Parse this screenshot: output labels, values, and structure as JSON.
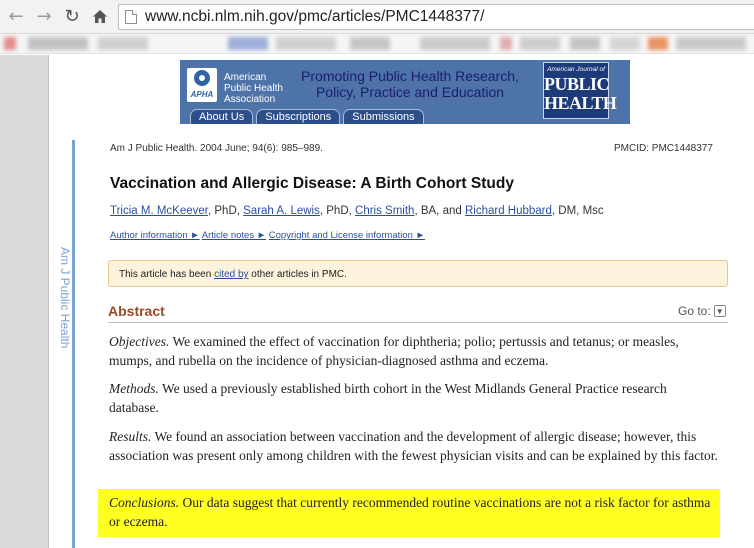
{
  "browser": {
    "url": "www.ncbi.nlm.nih.gov/pmc/articles/PMC1448377/",
    "bookmark_colors": [
      "#e07a7a",
      "#b9b9b9",
      "#c9c9c9",
      "#8fa3d6",
      "#c9c9c9",
      "#bdbdbd",
      "#c4c4c4",
      "#d9a0a0",
      "#c6c6c6",
      "#bcbcbc",
      "#cfcfcf",
      "#e8834a",
      "#c2c2c2"
    ]
  },
  "banner": {
    "logo_text": "APHA",
    "org_name": "American\nPublic Health\nAssociation",
    "slogan": "Promoting Public Health Research, Policy, Practice and Education",
    "journal_small": "American Journal of",
    "journal_big1": "PUBLIC",
    "journal_big2": "HEALTH",
    "tabs": [
      "About Us",
      "Subscriptions",
      "Submissions"
    ]
  },
  "sidebar": {
    "journal_vertical": "Am J Public Health"
  },
  "article": {
    "citation": "Am J Public Health. 2004 June; 94(6): 985–989.",
    "pmcid": "PMCID: PMC1448377",
    "title": "Vaccination and Allergic Disease: A Birth Cohort Study",
    "authors": [
      {
        "name": "Tricia M. McKeever",
        "suffix": ", PhD, "
      },
      {
        "name": "Sarah A. Lewis",
        "suffix": ", PhD, "
      },
      {
        "name": "Chris Smith",
        "suffix": ", BA, and "
      },
      {
        "name": "Richard Hubbard",
        "suffix": ", DM, Msc"
      }
    ],
    "info_links": [
      "Author information ►",
      "Article notes ►",
      "Copyright and License information ►"
    ],
    "cited_prefix": "This article has been ",
    "cited_link": "cited by",
    "cited_suffix": " other articles in PMC.",
    "abstract_heading": "Abstract",
    "goto_label": "Go to:",
    "highlight_color": "#ffff22",
    "abstract": [
      {
        "lead": "Objectives.",
        "text": " We examined the effect of vaccination for diphtheria; polio; pertussis and tetanus; or measles, mumps, and rubella on the incidence of physician-diagnosed asthma and eczema."
      },
      {
        "lead": "Methods.",
        "text": " We used a previously established birth cohort in the West Midlands General Practice research database."
      },
      {
        "lead": "Results.",
        "text": " We found an association between vaccination and the development of allergic disease; however, this association was present only among children with the fewest physician visits and can be explained by this factor."
      },
      {
        "lead": "Conclusions.",
        "text": " Our data suggest that currently recommended routine vaccinations are not a risk factor for asthma or eczema."
      }
    ]
  }
}
